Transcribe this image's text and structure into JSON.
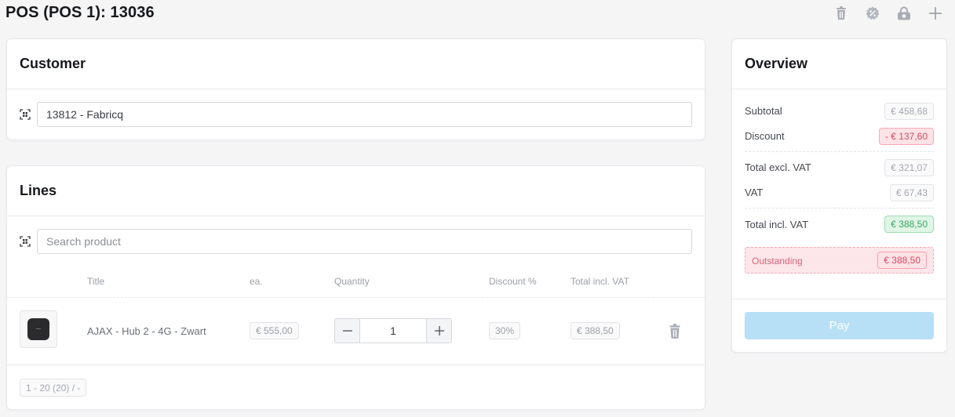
{
  "page": {
    "title": "POS (POS 1): 13036"
  },
  "top_actions": [
    {
      "name": "delete-order-button",
      "icon": "trash-icon"
    },
    {
      "name": "discount-button",
      "icon": "percent-badge-icon"
    },
    {
      "name": "lock-button",
      "icon": "lock-icon"
    },
    {
      "name": "new-order-button",
      "icon": "plus-icon"
    }
  ],
  "customer": {
    "heading": "Customer",
    "value": "13812 - Fabricq",
    "icon": "scan-icon"
  },
  "lines": {
    "heading": "Lines",
    "search_placeholder": "Search product",
    "columns": {
      "title": "Title",
      "each": "ea.",
      "quantity": "Quantity",
      "discount": "Discount %",
      "total": "Total incl. VAT"
    },
    "rows": [
      {
        "title": "AJAX - Hub 2 - 4G - Zwart",
        "each": "€ 555,00",
        "quantity": "1",
        "discount": "30%",
        "total": "€ 388,50"
      }
    ],
    "pagination": "1 - 20 (20) / -"
  },
  "overview": {
    "heading": "Overview",
    "subtotal_label": "Subtotal",
    "subtotal": "€ 458,68",
    "discount_label": "Discount",
    "discount": "- € 137,60",
    "total_excl_label": "Total excl. VAT",
    "total_excl": "€ 321,07",
    "vat_label": "VAT",
    "vat": "€ 67,43",
    "total_incl_label": "Total incl. VAT",
    "total_incl": "€ 388,50",
    "outstanding_label": "Outstanding",
    "outstanding": "€ 388,50",
    "pay_label": "Pay"
  },
  "colors": {
    "accent_pay": "#b7e0f7",
    "negative": "#d44a60",
    "positive": "#3aa55f"
  }
}
